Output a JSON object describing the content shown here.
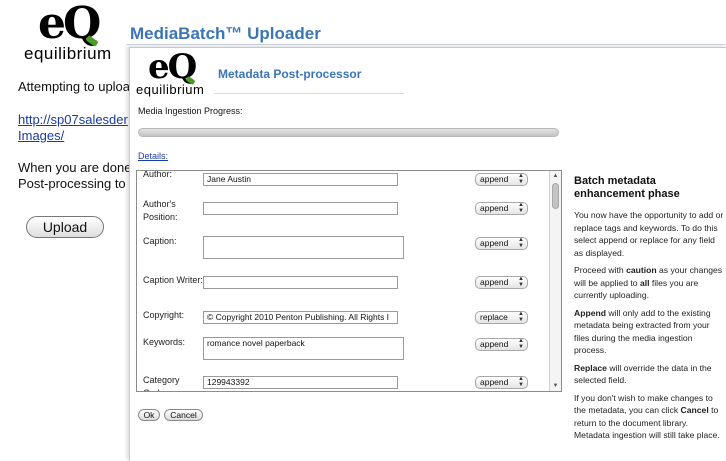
{
  "background": {
    "logo_word": "equilibrium",
    "logo_mark": "eQ",
    "title": "MediaBatch™ Uploader",
    "line1": "Attempting to uploa",
    "link_line1": "http://sp07salesder",
    "link_line2": "Images/",
    "line2": "When you are done",
    "line3": "Post-processing to s",
    "upload_button": "Upload"
  },
  "popup": {
    "logo_word": "equilibrium",
    "logo_mark": "eQ",
    "title": "Metadata Post-processor",
    "progress_label": "Media Ingestion Progress:",
    "progress_fraction": 0.0,
    "details_link": "Details:",
    "fields": [
      {
        "label": "Author:",
        "value": "Jane Austin",
        "mode": "append",
        "multiline": false
      },
      {
        "label": "Author's Position:",
        "value": "",
        "mode": "append",
        "multiline": false
      },
      {
        "label": "Caption:",
        "value": "",
        "mode": "append",
        "multiline": true
      },
      {
        "label": "Caption Writer:",
        "value": "",
        "mode": "append",
        "multiline": false
      },
      {
        "label": "Copyright:",
        "value": "© Copyright 2010 Penton Publishing. All Rights I",
        "mode": "replace",
        "multiline": false
      },
      {
        "label": "Keywords:",
        "value": "romance novel paperback",
        "mode": "append",
        "multiline": true
      },
      {
        "label": "Category Code:",
        "value": "129943392",
        "mode": "append",
        "multiline": false
      }
    ],
    "ok_button": "Ok",
    "cancel_button": "Cancel",
    "help": {
      "title": "Batch metadata enhancement phase",
      "p1": "You now have the opportunity to add or replace tags and keywords. To do this select append or replace for any field as displayed.",
      "p2_a": "Proceed with ",
      "p2_b": "caution",
      "p2_c": " as your changes will be applied to ",
      "p2_d": "all",
      "p2_e": " files you are currently uploading.",
      "p3_a": "Append",
      "p3_b": " will only add to the existing metadata being extracted from your files during the media ingestion process.",
      "p4_a": "Replace",
      "p4_b": " will override the data in the selected field.",
      "p5_a": "If you don't wish to make changes to the metadata, you can click ",
      "p5_b": "Cancel",
      "p5_c": " to return to the document library. Metadata ingestion will still take place."
    }
  }
}
